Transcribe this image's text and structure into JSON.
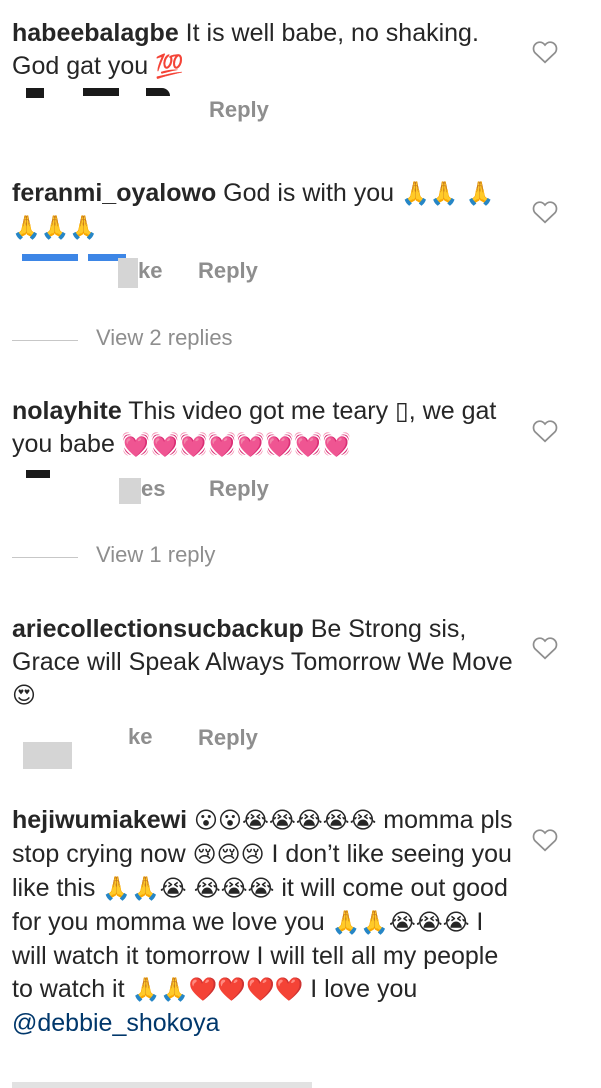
{
  "comments": [
    {
      "username": "habeebalagbe",
      "text": " It is well babe, no shaking. God gat you ",
      "emoji_tail": "💯",
      "likes_fragment": "",
      "reply_label": "Reply"
    },
    {
      "username": "feranmi_oyalowo",
      "text": " God is with you ",
      "emoji_tail": "🙏🙏 🙏🙏🙏🙏",
      "likes_fragment": "ke",
      "reply_label": "Reply",
      "view_replies": "View 2 replies"
    },
    {
      "username": "nolayhite",
      "text": " This video got me teary ",
      "text_box": "▯",
      "text2": ", we gat you babe ",
      "emoji_tail": "💓💓💓💓💓💓💓💓",
      "likes_fragment": "es",
      "reply_label": "Reply",
      "view_replies": "View 1 reply"
    },
    {
      "username": "ariecollectionsucbackup",
      "text": " Be Strong sis, Grace will Speak Always Tomorrow We Move",
      "emoji_tail": "😍",
      "likes_fragment": "ke",
      "reply_label": "Reply"
    },
    {
      "username": "hejiwumiakewi",
      "seg1_emoji": "😮😮😭😭😭😭😭",
      "seg2": " momma pls stop crying now ",
      "seg3_emoji": "😢😢😢",
      "seg4": " I don’t like seeing you like this ",
      "seg5_emoji": "🙏🙏😭 😭😭😭",
      "seg6": " it will come out good for you momma we love you ",
      "seg7_emoji": "🙏🙏😭😭😭",
      "seg8": " I will watch it tomorrow I will tell all my people to watch it ",
      "seg9_emoji": "🙏🙏❤️❤️❤️❤️",
      "seg10": " I love you ",
      "mention": "@debbie_shokoya"
    }
  ],
  "icons": {
    "like": "heart-outline-icon"
  },
  "colors": {
    "text": "#262626",
    "muted": "#8e8e8e",
    "mention": "#00376b"
  }
}
